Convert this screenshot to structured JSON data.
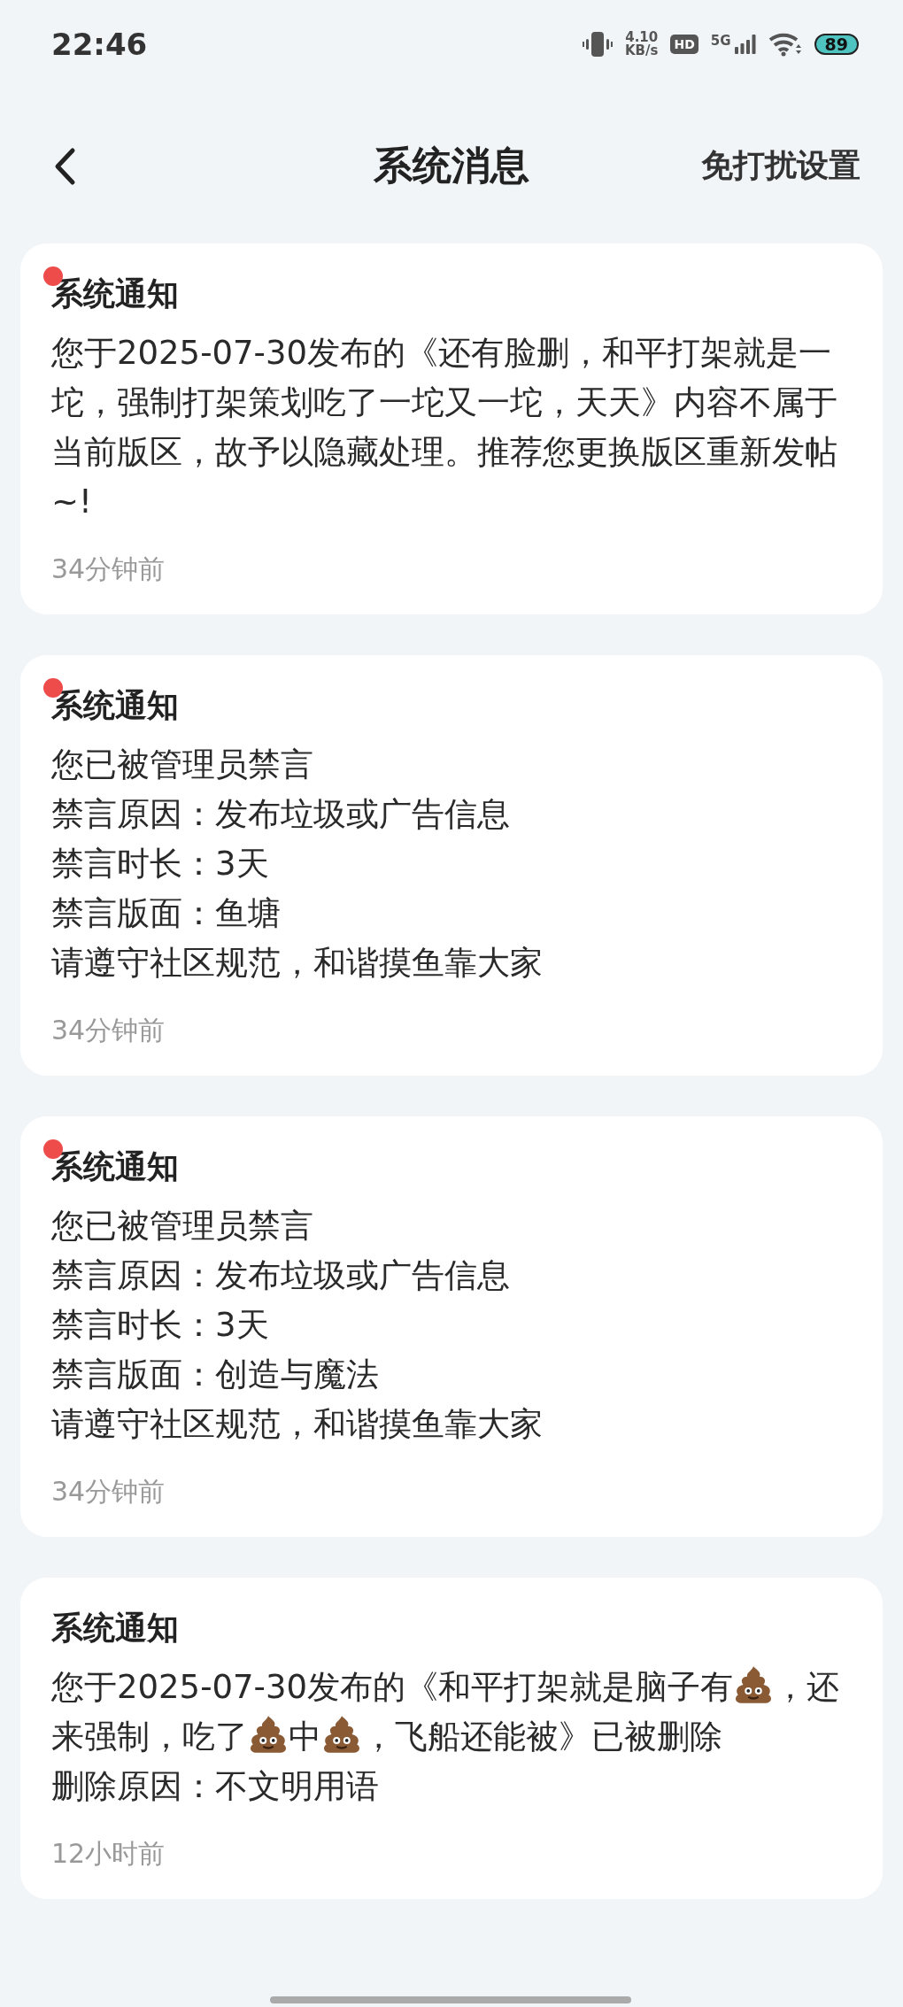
{
  "status_bar": {
    "time": "22:46",
    "speed_value": "4.10",
    "speed_unit": "KB/s",
    "hd_badge": "HD",
    "network": "5G",
    "battery": "89"
  },
  "header": {
    "title": "系统消息",
    "action": "免打扰设置"
  },
  "messages": [
    {
      "title": "系统通知",
      "unread": true,
      "body": [
        [
          {
            "kind": "text",
            "text": "您于2025-07-30发布的《还有脸删，和平打架就是一坨，强制打架策划吃了一坨又一坨，天天》内容不属于当前版区，故予以隐藏处理。推荐您更换版区重新发帖~!"
          }
        ]
      ],
      "time": "34分钟前"
    },
    {
      "title": "系统通知",
      "unread": true,
      "body": [
        [
          {
            "kind": "text",
            "text": "您已被管理员禁言"
          }
        ],
        [
          {
            "kind": "text",
            "text": "禁言原因：发布垃圾或广告信息"
          }
        ],
        [
          {
            "kind": "text",
            "text": "禁言时长：3天"
          }
        ],
        [
          {
            "kind": "text",
            "text": "禁言版面：鱼塘"
          }
        ],
        [
          {
            "kind": "text",
            "text": "请遵守社区规范，和谐摸鱼靠大家"
          }
        ]
      ],
      "time": "34分钟前"
    },
    {
      "title": "系统通知",
      "unread": true,
      "body": [
        [
          {
            "kind": "text",
            "text": "您已被管理员禁言"
          }
        ],
        [
          {
            "kind": "text",
            "text": "禁言原因：发布垃圾或广告信息"
          }
        ],
        [
          {
            "kind": "text",
            "text": "禁言时长：3天"
          }
        ],
        [
          {
            "kind": "text",
            "text": "禁言版面：创造与魔法"
          }
        ],
        [
          {
            "kind": "text",
            "text": "请遵守社区规范，和谐摸鱼靠大家"
          }
        ]
      ],
      "time": "34分钟前"
    },
    {
      "title": "系统通知",
      "unread": false,
      "body": [
        [
          {
            "kind": "text",
            "text": "您于2025-07-30发布的《和平打架就是脑子有"
          },
          {
            "kind": "poop"
          },
          {
            "kind": "text",
            "text": "，还来强制，吃了"
          },
          {
            "kind": "poop"
          },
          {
            "kind": "text",
            "text": "中"
          },
          {
            "kind": "poop"
          },
          {
            "kind": "text",
            "text": "，飞船还能被》已被删除"
          }
        ],
        [
          {
            "kind": "text",
            "text": "删除原因：不文明用语"
          }
        ]
      ],
      "time": "12小时前"
    }
  ]
}
